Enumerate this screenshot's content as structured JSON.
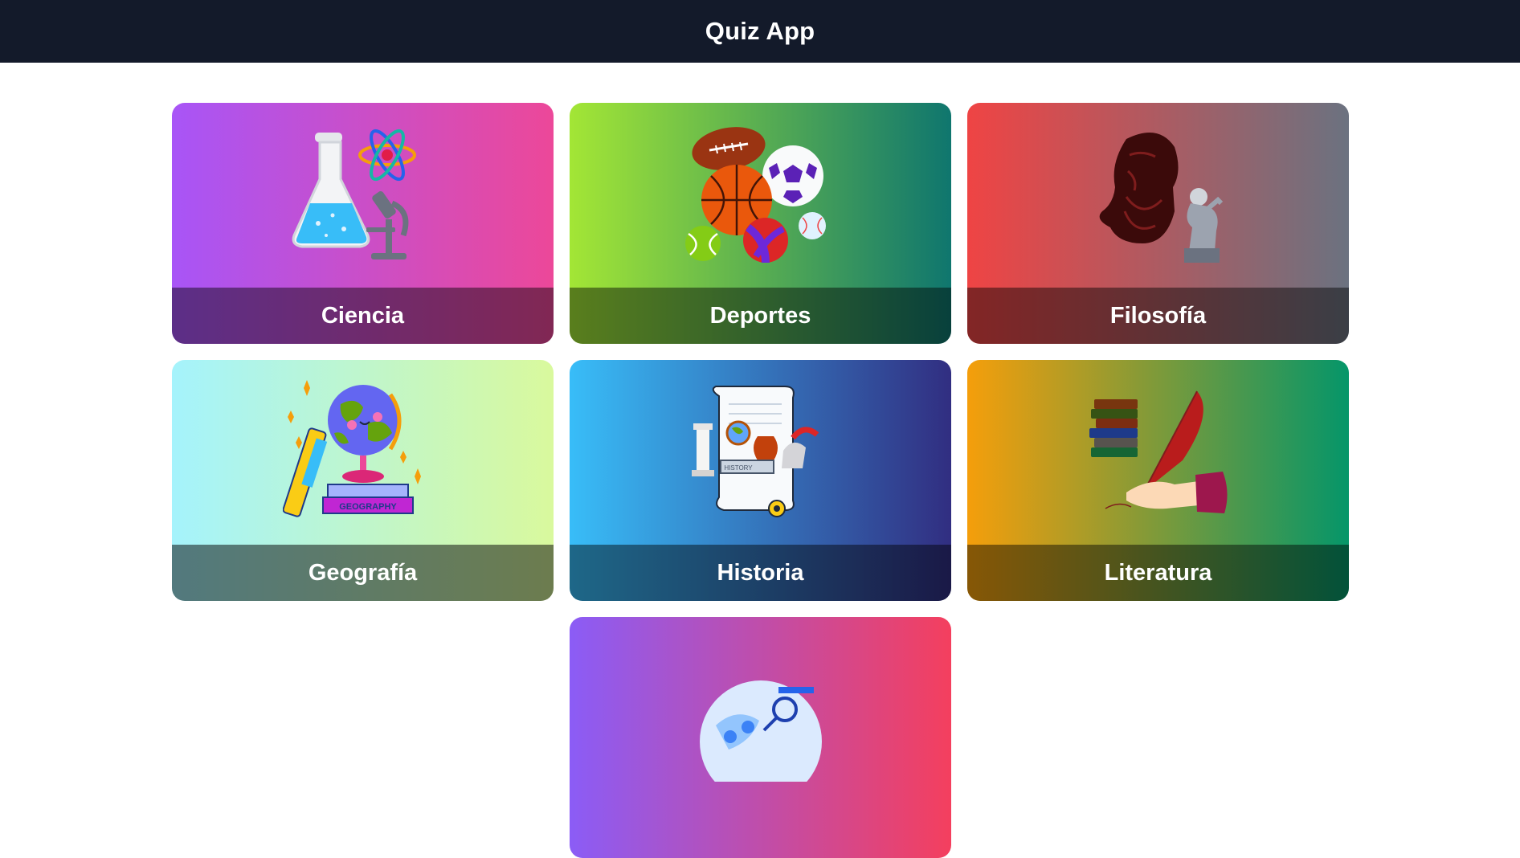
{
  "header": {
    "title": "Quiz App"
  },
  "categories": [
    {
      "label": "Ciencia",
      "icon": "science-flask-atom-microscope-icon"
    },
    {
      "label": "Deportes",
      "icon": "sports-balls-icon"
    },
    {
      "label": "Filosofía",
      "icon": "philosopher-thinker-icon"
    },
    {
      "label": "Geografía",
      "icon": "globe-books-icon"
    },
    {
      "label": "Historia",
      "icon": "history-scroll-icon"
    },
    {
      "label": "Literatura",
      "icon": "books-quill-icon"
    }
  ],
  "partial_card": {
    "icon": "brain-globe-icon"
  },
  "colors": {
    "header_bg": "#131a2a",
    "ciencia": [
      "#a855f7",
      "#ec4899"
    ],
    "deportes": [
      "#a3e635",
      "#0f766e"
    ],
    "filosofia": [
      "#ef4444",
      "#6b7280"
    ],
    "geografia": [
      "#a5f3fc",
      "#d9f99d"
    ],
    "historia": [
      "#38bdf8",
      "#312e81"
    ],
    "literatura": [
      "#f59e0b",
      "#059669"
    ],
    "partial": [
      "#8b5cf6",
      "#f43f5e"
    ]
  }
}
